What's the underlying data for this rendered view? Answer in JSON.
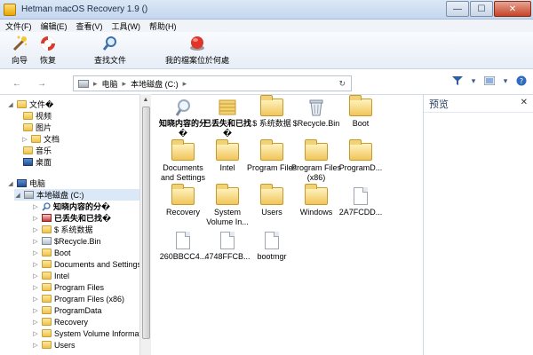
{
  "window": {
    "title": "Hetman macOS Recovery 1.9 ()",
    "minimize": "—",
    "maximize": "☐",
    "close": "✕"
  },
  "menu": {
    "file": "文件(F)",
    "edit": "编辑(E)",
    "view": "查看(V)",
    "tools": "工具(W)",
    "help": "帮助(H)"
  },
  "toolbar": {
    "wizard": "向导",
    "recover": "恢复",
    "find": "查找文件",
    "where": "我的檔案位於何處"
  },
  "address": {
    "back": "←",
    "forward": "→",
    "segment1": "电脑",
    "segment2": "本地磁盘 (C:)",
    "sep": "▸",
    "refresh": "↻"
  },
  "tree": {
    "files_root": "文件�",
    "videos": "视频",
    "pictures": "图片",
    "docs": "文档",
    "music": "音乐",
    "desktop": "桌面",
    "computer": "电脑",
    "local_disk": "本地磁盘 (C:)",
    "items": [
      "知晓内容的分�",
      "已丢失和已找�",
      "$ 系统数据",
      "$Recycle.Bin",
      "Boot",
      "Documents and Settings",
      "Intel",
      "Program Files",
      "Program Files (x86)",
      "ProgramData",
      "Recovery",
      "System Volume Informat",
      "Users"
    ]
  },
  "files": {
    "f1": "知晓内容的分�",
    "f2": "已丢失和已找�",
    "f3": "$ 系统数据",
    "f4": "$Recycle.Bin",
    "f5": "Boot",
    "f6": "Documents and Settings",
    "f7": "Intel",
    "f8": "Program Files",
    "f9": "Program Files (x86)",
    "f10": "ProgramD...",
    "f11": "Recovery",
    "f12": "System Volume In...",
    "f13": "Users",
    "f14": "Windows",
    "f15": "2A7FCDD...",
    "f16": "260BBCC4...",
    "f17": "4748FFCB...",
    "f18": "bootmgr"
  },
  "preview": {
    "title": "预览",
    "close": "✕"
  }
}
